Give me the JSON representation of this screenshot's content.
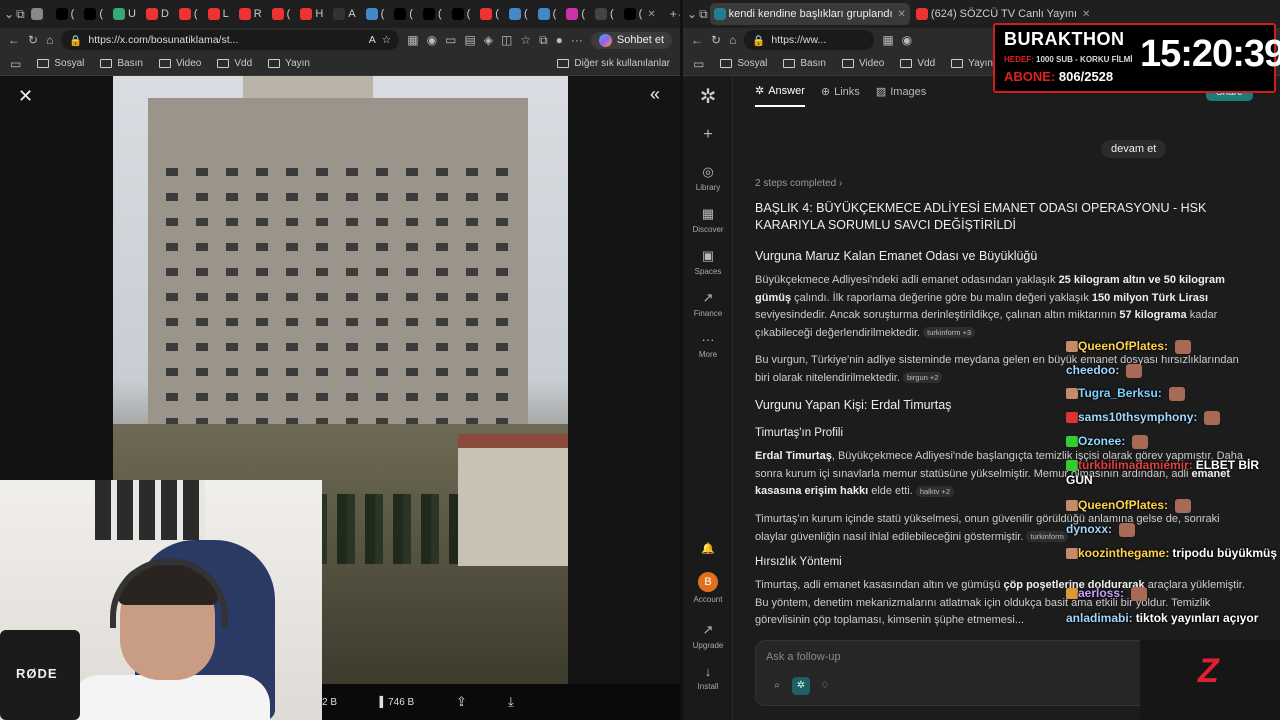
{
  "left_window": {
    "tabs": [
      {
        "label": "",
        "color": "#888"
      },
      {
        "label": "(",
        "color": "#000"
      },
      {
        "label": "(",
        "color": "#000"
      },
      {
        "label": "U",
        "color": "#3a7"
      },
      {
        "label": "D",
        "color": "#e33"
      },
      {
        "label": "(",
        "color": "#e33"
      },
      {
        "label": "L",
        "color": "#e33"
      },
      {
        "label": "R",
        "color": "#e33"
      },
      {
        "label": "(",
        "color": "#e33"
      },
      {
        "label": "H",
        "color": "#e33"
      },
      {
        "label": "A",
        "color": "#333"
      },
      {
        "label": "(",
        "color": "#48c"
      },
      {
        "label": "(",
        "color": "#000"
      },
      {
        "label": "(",
        "color": "#000"
      },
      {
        "label": "(",
        "color": "#000"
      },
      {
        "label": "(",
        "color": "#e33"
      },
      {
        "label": "(",
        "color": "#48c"
      },
      {
        "label": "(",
        "color": "#48c"
      },
      {
        "label": "(",
        "color": "#c3a"
      },
      {
        "label": "(",
        "color": "#444"
      },
      {
        "label": "(",
        "color": "#000"
      }
    ],
    "url": "https://x.com/bosunatiklama/st...",
    "copilot_label": "Sohbet et",
    "bookmarks": [
      "Sosyal",
      "Basın",
      "Video",
      "Vdd",
      "Yayın"
    ],
    "other_bookmarks": "Diğer sık kullanılanlar",
    "viewer": {
      "stat_left": "2 B",
      "stat_views": "746 B"
    }
  },
  "right_window": {
    "tab_title": "kendi kendine başlıkları gruplandı",
    "tab2_title": "(624) SÖZCÜ TV Canlı Yayını",
    "url": "https://ww...",
    "bookmarks": [
      "Sosyal",
      "Basın",
      "Video",
      "Vdd",
      "Yayın"
    ],
    "sidebar": [
      {
        "name": "library",
        "label": "Library",
        "icon": "◎"
      },
      {
        "name": "discover",
        "label": "Discover",
        "icon": "▦"
      },
      {
        "name": "spaces",
        "label": "Spaces",
        "icon": "▣"
      },
      {
        "name": "finance",
        "label": "Finance",
        "icon": "↗"
      },
      {
        "name": "more",
        "label": "More",
        "icon": "···"
      },
      {
        "name": "account",
        "label": "Account",
        "icon": "B"
      },
      {
        "name": "upgrade",
        "label": "Upgrade",
        "icon": "↗"
      },
      {
        "name": "install",
        "label": "Install",
        "icon": "↓"
      }
    ],
    "tabs": {
      "answer": "Answer",
      "links": "Links",
      "images": "Images"
    },
    "share_label": "Share",
    "user_message": "devam et",
    "steps": "2 steps completed",
    "heading": "BAŞLIK 4: BÜYÜKÇEKMECE ADLİYESİ EMANET ODASI OPERASYONU - HSK KARARIYLA SORUMLU SAVCI DEĞİŞTİRİLDİ",
    "sub1": "Vurguna Maruz Kalan Emanet Odası ve Büyüklüğü",
    "para1": {
      "a": "Büyükçekmece Adliyesi'ndeki adli emanet odasından yaklaşık ",
      "b1": "25 kilogram altın ve 50 kilogram gümüş",
      "c": " çalındı. İlk raporlama değerine göre bu malın değeri yaklaşık ",
      "b2": "150 milyon Türk Lirası",
      "d": " seviyesindedir. Ancak soruşturma derinleştirildikçe, çalınan altın miktarının ",
      "b3": "57 kilograma",
      "e": " kadar çıkabileceği değerlendirilmektedir.",
      "src": "turkinform +3"
    },
    "para2": {
      "text": "Bu vurgun, Türkiye'nin adliye sisteminde meydana gelen en büyük emanet dosyası hırsızlıklarından biri olarak nitelendirilmektedir.",
      "src": "birgun +2"
    },
    "sub2": "Vurgunu Yapan Kişi: Erdal Timurtaş",
    "sub3": "Timurtaş'ın Profili",
    "para3": {
      "b1": "Erdal Timurtaş",
      "a": ", Büyükçekmece Adliyesi'nde başlangıçta temizlik işçisi olarak görev yapmıştır. Daha sonra kurum içi sınavlarla memur statüsüne yükselmiştir. Memur olmasının ardından, adli ",
      "b2": "emanet kasasına erişim hakkı",
      "c": " elde etti.",
      "src": "halktv +2"
    },
    "para4": {
      "text": "Timurtaş'ın kurum içinde statü yükselmesi, onun güvenilir görüldüğü anlamına gelse de, sonraki olaylar güvenliğin nasıl ihlal edilebileceğini göstermiştir.",
      "src": "turkinform"
    },
    "sub4": "Hırsızlık Yöntemi",
    "para5": {
      "a": "Timurtaş, adli emanet kasasından altın ve gümüşü ",
      "b1": "çöp poşetlerine doldurarak",
      "c": " araçlara yüklemiştir. Bu yöntem, denetim mekanizmalarını atlatmak için oldukça basit ama etkili bir yoldur. Temizlik görevlisinin çöp toplaması, kimsenin şüphe etmemesi..."
    },
    "followup_placeholder": "Ask a follow-up"
  },
  "overlay": {
    "streamer": "BURAKTHON",
    "goal_label": "HEDEF:",
    "goal_text": "1000 SUB - KORKU FİLMİ",
    "sub_label": "ABONE:",
    "sub_count": "806/2528",
    "clock": "15:20:39",
    "chat": [
      {
        "user": "QueenOfPlates:",
        "msg": "",
        "color": "#ffd24a",
        "badge": "#c58a6a"
      },
      {
        "user": "cheedoo:",
        "msg": "",
        "color": "#9fd7ff",
        "badge": ""
      },
      {
        "user": "Tugra_Berksu:",
        "msg": "",
        "color": "#7fd0ff",
        "badge": "#c58a6a"
      },
      {
        "user": "sams10thsymphony:",
        "msg": "",
        "color": "#9fd7ff",
        "badge": "#d33"
      },
      {
        "user": "Ozonee:",
        "msg": "",
        "color": "#8fd7ff",
        "badge": "#3c3"
      },
      {
        "user": "turkbilimadamiemir:",
        "msg": "ELBET BİR GÜN",
        "color": "#e04040",
        "badge": "#3c3"
      },
      {
        "user": "QueenOfPlates:",
        "msg": "",
        "color": "#ffd24a",
        "badge": "#c58a6a"
      },
      {
        "user": "dynoxx:",
        "msg": "",
        "color": "#9fd7ff",
        "badge": ""
      },
      {
        "user": "koozinthegame:",
        "msg": "tripodu büyükmüş",
        "color": "#ffd24a",
        "badge": "#c58a6a"
      },
      {
        "user": "aerloss:",
        "msg": "",
        "color": "#c9a0ff",
        "badge": "#d93"
      },
      {
        "user": "anladimabi:",
        "msg": "tiktok yayınları açıyor",
        "color": "#9fd7ff",
        "badge": ""
      }
    ]
  },
  "colors": {
    "accent_red": "#e02020",
    "share_teal": "#1f7a7a"
  }
}
